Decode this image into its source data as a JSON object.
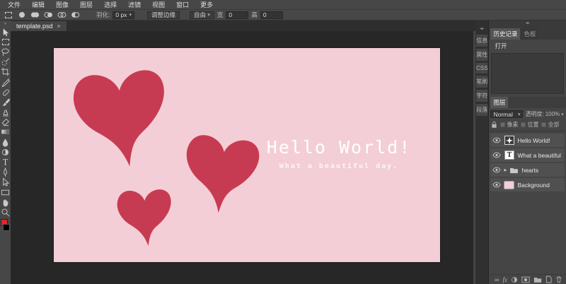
{
  "app": {
    "menu": [
      "文件",
      "编辑",
      "图像",
      "图层",
      "选择",
      "滤镜",
      "视图",
      "窗口",
      "更多"
    ],
    "options": {
      "feather_label": "羽化:",
      "feather_value": "0 px",
      "refine_edge": "调整边缘",
      "aspect_mode": "自由",
      "width_label": "宽",
      "width_value": "0",
      "height_label": "高",
      "height_value": "0"
    },
    "doc_tab": {
      "title": "template.psd",
      "close": "×"
    },
    "toolbar_overflow": "»",
    "tools": [
      "move",
      "marquee-select",
      "lasso",
      "quick-select",
      "crop",
      "eyedropper",
      "healing",
      "brush",
      "clone-stamp",
      "eraser",
      "gradient",
      "blur",
      "dodge",
      "type",
      "pen",
      "path-select",
      "rectangle-shape",
      "hand",
      "zoom"
    ],
    "colors": {
      "foreground_swatch": "#e3252b",
      "background_swatch": "#000000",
      "canvas_background": "#f3ced6",
      "heart_red": "#c73b52"
    }
  },
  "canvas": {
    "title": "Hello World!",
    "subtitle": "What a beautiful day."
  },
  "right_panel": {
    "collapse_icon": "◂▸",
    "side_tabs": [
      "信息",
      "属性",
      "CSS",
      "笔刷",
      "字符",
      "段落"
    ],
    "history": {
      "tab_history": "历史记录",
      "tab_swatches": "色板",
      "entries": [
        "打开"
      ]
    },
    "layers": {
      "tab": "图层",
      "blend_mode": "Normal",
      "opacity_label": "透明度:",
      "opacity_value": "100%",
      "lock_labels": [
        "像素",
        "位置",
        "全部"
      ],
      "items": [
        {
          "name": "Hello World!",
          "type": "smart-object"
        },
        {
          "name": "What a beautiful day.",
          "type": "text"
        },
        {
          "name": "hearts",
          "type": "group"
        },
        {
          "name": "Background",
          "type": "image"
        }
      ],
      "bottom_icons": [
        "link-icon",
        "fx-icon",
        "adjustment-icon",
        "mask-icon",
        "new-folder-icon",
        "new-layer-icon",
        "delete-layer-icon"
      ]
    }
  }
}
